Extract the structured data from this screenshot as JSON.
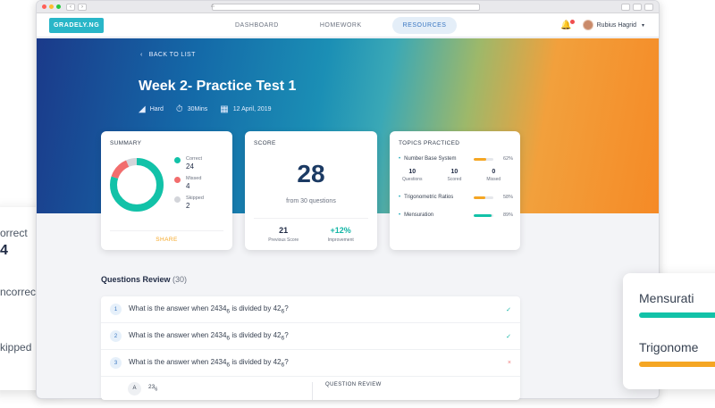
{
  "browser": {
    "nav_back": "‹",
    "nav_forward": "›",
    "home_glyph": "⌂"
  },
  "brand": {
    "logo_text": "GRADELY.NG"
  },
  "nav": {
    "links": [
      "DASHBOARD",
      "HOMEWORK",
      "RESOURCES"
    ],
    "active": "RESOURCES",
    "user_name": "Rubius Hagrid"
  },
  "hero": {
    "back_label": "BACK TO LIST",
    "title": "Week 2- Practice Test 1",
    "difficulty": "Hard",
    "duration": "30Mins",
    "date": "12 April, 2019"
  },
  "summary": {
    "heading": "SUMMARY",
    "items": [
      {
        "label": "Correct",
        "value": "24",
        "color": "#12c2a8"
      },
      {
        "label": "Missed",
        "value": "4",
        "color": "#f26d6d"
      },
      {
        "label": "Skipped",
        "value": "2",
        "color": "#d3d5da"
      }
    ],
    "share_label": "SHARE"
  },
  "score": {
    "heading": "SCORE",
    "value": "28",
    "subtitle": "from 30 questions",
    "previous_value": "21",
    "previous_label": "Previous Score",
    "improvement_value": "+12%",
    "improvement_label": "Improvement"
  },
  "topics": {
    "heading": "TOPICS PRACTICED",
    "items": [
      {
        "name": "Number Base System",
        "percent": "62%",
        "fraction": 0.62,
        "color": "#f5a623"
      },
      {
        "name": "Trigonometric Ratios",
        "percent": "58%",
        "fraction": 0.58,
        "color": "#f5a623"
      },
      {
        "name": "Mensuration",
        "percent": "89%",
        "fraction": 0.89,
        "color": "#12c2a8"
      }
    ],
    "stats": [
      {
        "value": "10",
        "label": "Questions"
      },
      {
        "value": "10",
        "label": "Scored"
      },
      {
        "value": "0",
        "label": "Missed"
      }
    ]
  },
  "review": {
    "title": "Questions Review",
    "count": "(30)",
    "questions": [
      {
        "num": "1",
        "text_main": "What is the answer when 2434",
        "sub1": "6",
        "text_mid": " is divided by 42",
        "sub2": "6",
        "text_end": "?",
        "status": "correct"
      },
      {
        "num": "2",
        "text_main": "What is the answer when 2434",
        "sub1": "6",
        "text_mid": " is divided by 42",
        "sub2": "6",
        "text_end": "?",
        "status": "correct"
      },
      {
        "num": "3",
        "text_main": "What is the answer when 2434",
        "sub1": "6",
        "text_mid": " is divided by 42",
        "sub2": "6",
        "text_end": "?",
        "status": "wrong"
      }
    ],
    "option_letter": "A",
    "option_text": "23",
    "option_sub": "6",
    "review_label": "QUESTION REVIEW"
  },
  "side_left": {
    "items": [
      {
        "label": "orrect",
        "value": "4"
      },
      {
        "label": "ncorrect",
        "value": ""
      },
      {
        "label": "kipped",
        "value": ""
      }
    ]
  },
  "side_right": {
    "items": [
      {
        "label": "Mensurati",
        "color": "#12c2a8"
      },
      {
        "label": "Trigonome",
        "color": "#f5a623"
      }
    ]
  },
  "icons": {
    "bell": "🔔",
    "check": "✓",
    "cross": "×",
    "chevron_left": "‹",
    "clock": "⏱",
    "calendar": "▦",
    "difficulty": "◢",
    "bullet": "•",
    "caret_down": "▾"
  }
}
